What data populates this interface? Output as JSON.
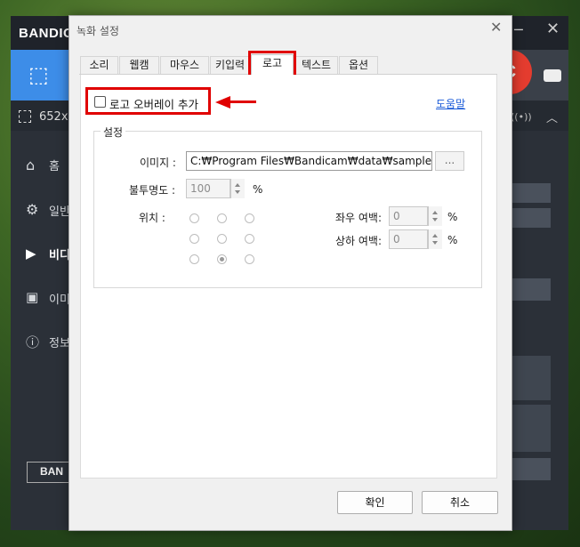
{
  "background_app": {
    "logo": "BANDIC",
    "size_text": "652x6",
    "sidebar": [
      {
        "icon": "home-icon",
        "label": "홈"
      },
      {
        "icon": "gear-icon",
        "label": "일반"
      },
      {
        "icon": "video-icon",
        "label": "비디"
      },
      {
        "icon": "image-icon",
        "label": "이미"
      },
      {
        "icon": "info-icon",
        "label": "정보"
      }
    ],
    "rec_label": "C",
    "bottom_logo": "BAN"
  },
  "dialog": {
    "title": "녹화 설정",
    "tabs": [
      "소리",
      "웹캠",
      "마우스",
      "키입력",
      "로고",
      "텍스트",
      "옵션"
    ],
    "active_tab": "로고",
    "overlay_label": "로고 오버레이 추가",
    "overlay_checked": false,
    "help": "도움말",
    "group_label": "설정",
    "image_label": "이미지 :",
    "image_path": "C:₩Program Files₩Bandicam₩data₩sample.png",
    "image_browse": "...",
    "opacity_label": "불투명도 :",
    "opacity_value": "100",
    "percent": "%",
    "position_label": "위치 :",
    "position_selected": "bottom-center",
    "h_margin_label": "좌우 여백:",
    "h_margin_value": "0",
    "v_margin_label": "상하 여백:",
    "v_margin_value": "0",
    "ok": "확인",
    "cancel": "취소"
  },
  "colors": {
    "highlight": "#e00000",
    "link": "#1a5bd8",
    "app_accent": "#3d8de8",
    "rec": "#e43c2f"
  }
}
